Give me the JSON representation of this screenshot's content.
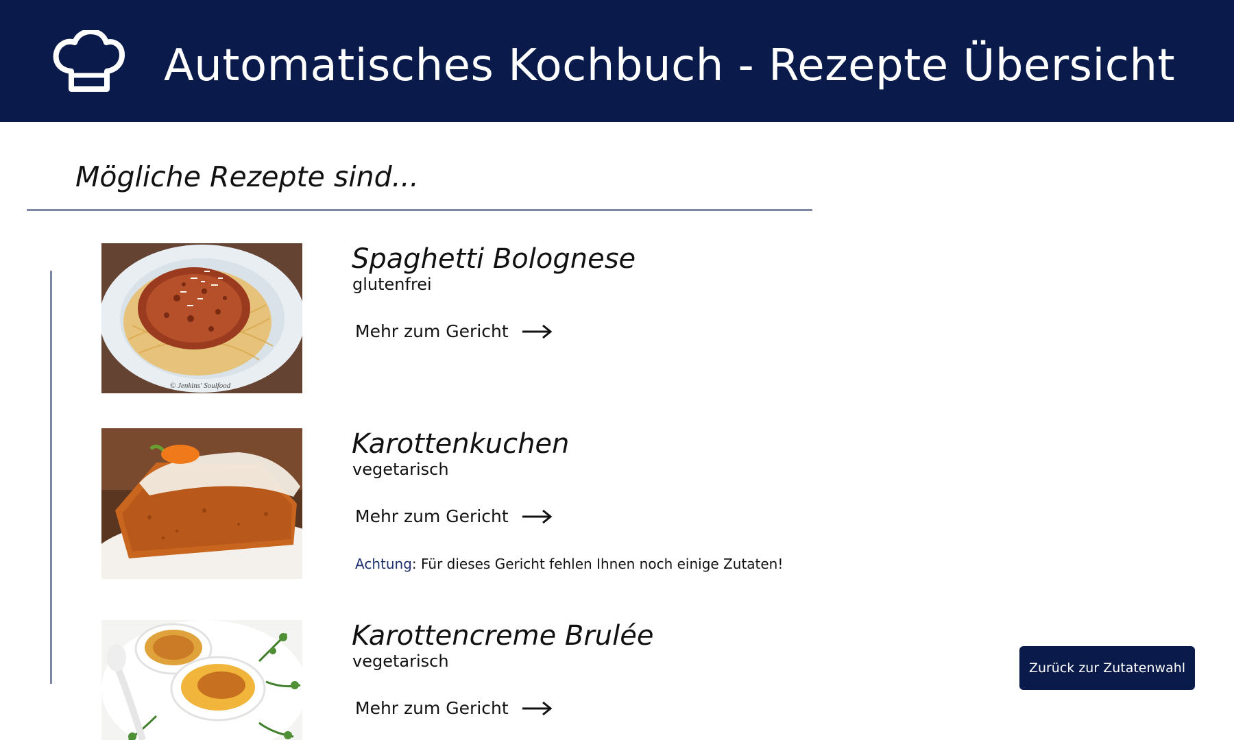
{
  "header": {
    "icon": "chef-hat-icon",
    "title": "Automatisches Kochbuch - Rezepte Übersicht",
    "background": "#0a1a4a"
  },
  "main": {
    "subtitle": "Mögliche Rezepte sind..."
  },
  "recipes": [
    {
      "name": "Spaghetti Bolognese",
      "diet": "glutenfrei",
      "link_label": "Mehr zum Gericht",
      "image": "spaghetti-bolognese-photo",
      "photo_credit": "© Jenkins' Soulfood"
    },
    {
      "name": "Karottenkuchen",
      "diet": "vegetarisch",
      "link_label": "Mehr zum Gericht",
      "image": "carrot-cake-photo",
      "warning_label": "Achtung",
      "warning_text": ": Für dieses Gericht fehlen Ihnen noch einige Zutaten!"
    },
    {
      "name": "Karottencreme Brulée",
      "diet": "vegetarisch",
      "link_label": "Mehr zum Gericht",
      "image": "carrot-creme-brulee-photo"
    }
  ],
  "back_button": {
    "label": "Zurück zur Zutatenwahl"
  },
  "colors": {
    "navy": "#0a1a4a",
    "divider": "#7e86a6",
    "warning_accent": "#1e2f6e"
  }
}
